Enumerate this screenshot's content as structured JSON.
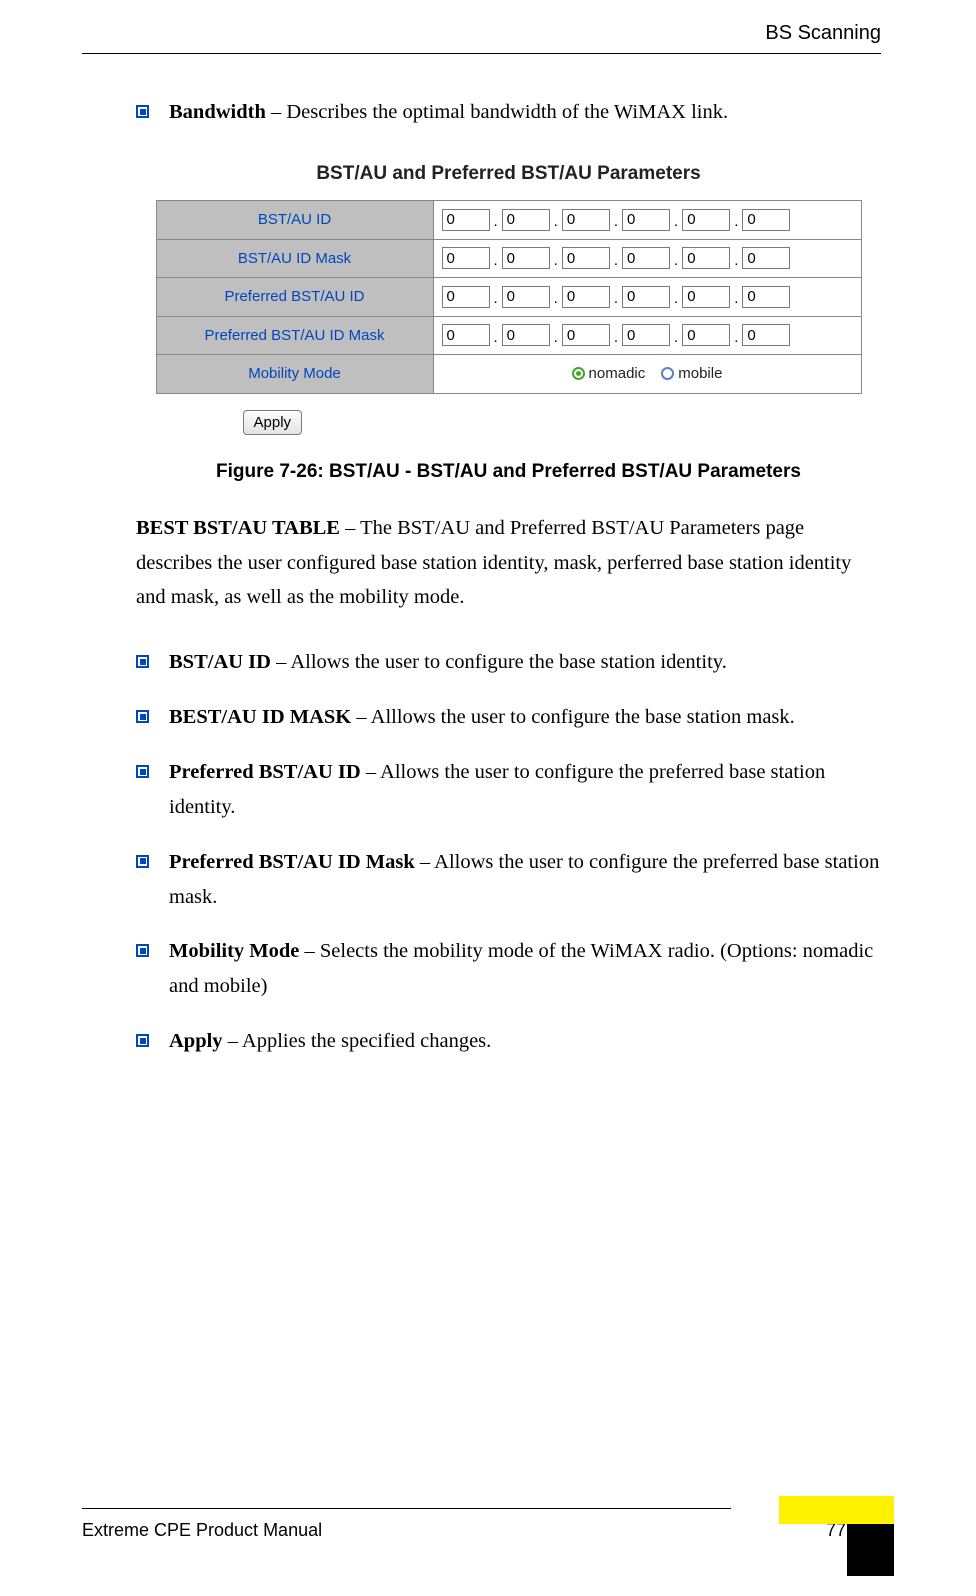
{
  "header": {
    "section": "BS Scanning"
  },
  "bullets_top": [
    {
      "term": "Bandwidth",
      "desc": " – Describes the optimal bandwidth of the WiMAX link."
    }
  ],
  "ui": {
    "title": "BST/AU and Preferred BST/AU Parameters",
    "rows": [
      {
        "label": "BST/AU ID",
        "vals": [
          "0",
          "0",
          "0",
          "0",
          "0",
          "0"
        ]
      },
      {
        "label": "BST/AU ID Mask",
        "vals": [
          "0",
          "0",
          "0",
          "0",
          "0",
          "0"
        ]
      },
      {
        "label": "Preferred BST/AU ID",
        "vals": [
          "0",
          "0",
          "0",
          "0",
          "0",
          "0"
        ]
      },
      {
        "label": "Preferred BST/AU ID Mask",
        "vals": [
          "0",
          "0",
          "0",
          "0",
          "0",
          "0"
        ]
      }
    ],
    "mobility_label": "Mobility Mode",
    "mobility_options": {
      "opt1": "nomadic",
      "opt2": "mobile",
      "selected": "nomadic"
    },
    "apply": "Apply"
  },
  "figure_caption": "Figure 7-26: BST/AU - BST/AU and Preferred BST/AU Parameters",
  "para": {
    "term": "BEST BST/AU TABLE",
    "text": " – The BST/AU and Preferred BST/AU Parameters page describes the user configured base station identity, mask, perferred base station identity and mask, as well as the mobility mode."
  },
  "bullets_bottom": [
    {
      "term": "BST/AU ID",
      "desc": " – Allows the user to configure the base station identity."
    },
    {
      "term": "BEST/AU ID MASK",
      "desc": " – Alllows the user to configure the base station mask."
    },
    {
      "term": "Preferred BST/AU ID",
      "desc": " – Allows the user to configure the preferred base station identity."
    },
    {
      "term": "Preferred BST/AU ID Mask",
      "desc": " – Allows the user to configure the preferred base station mask."
    },
    {
      "term": "Mobility Mode",
      "desc": " – Selects the mobility mode of the WiMAX radio. (Options: nomadic and mobile)"
    },
    {
      "term": "Apply",
      "desc": " – Applies the specified changes."
    }
  ],
  "footer": {
    "left": "Extreme CPE Product Manual",
    "page": "77"
  }
}
